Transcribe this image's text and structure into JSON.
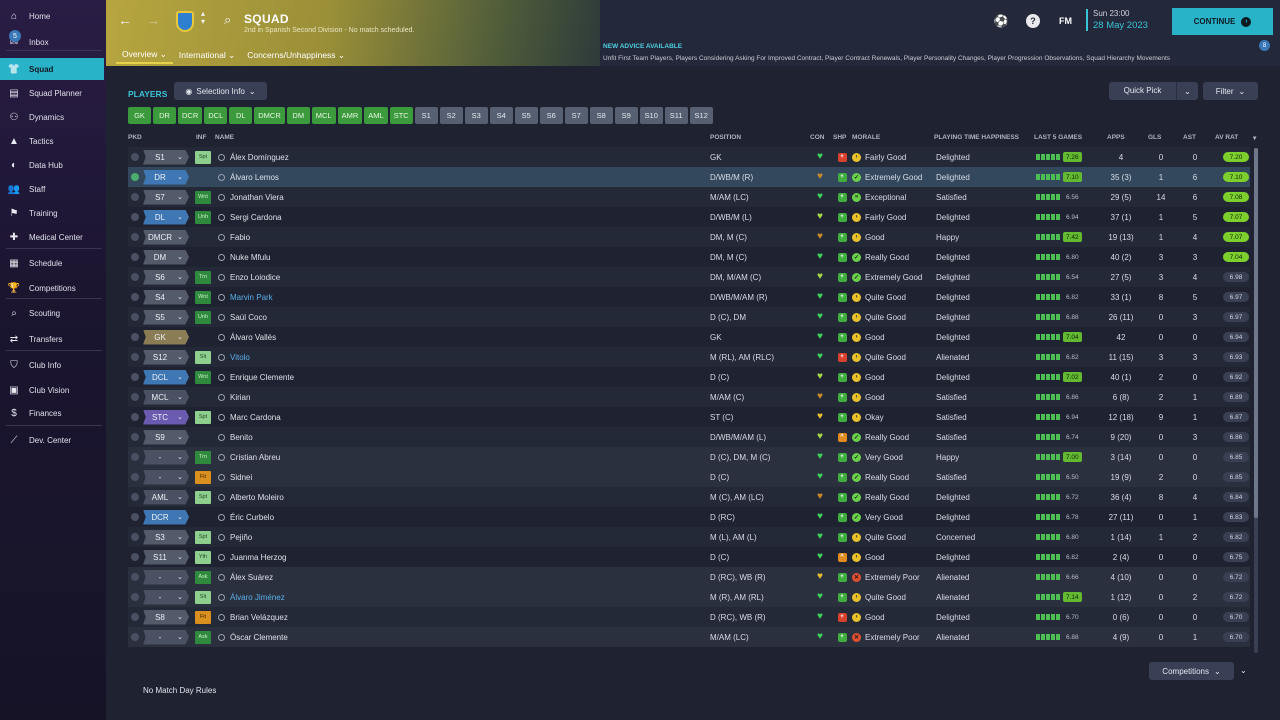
{
  "sidebar": {
    "items": [
      {
        "label": "Home",
        "icon": "home-icon",
        "glyph": "⌂"
      },
      {
        "label": "Inbox",
        "icon": "inbox-icon",
        "glyph": "✉",
        "badge": "5"
      },
      {
        "label": "Squad",
        "icon": "shirt-icon",
        "glyph": "👕"
      },
      {
        "label": "Squad Planner",
        "icon": "planner-icon",
        "glyph": "▤"
      },
      {
        "label": "Dynamics",
        "icon": "dynamics-icon",
        "glyph": "⚇"
      },
      {
        "label": "Tactics",
        "icon": "tactics-icon",
        "glyph": "▲"
      },
      {
        "label": "Data Hub",
        "icon": "data-hub-icon",
        "glyph": "◐"
      },
      {
        "label": "Staff",
        "icon": "staff-icon",
        "glyph": "👥"
      },
      {
        "label": "Training",
        "icon": "training-icon",
        "glyph": "⚑"
      },
      {
        "label": "Medical Center",
        "icon": "medical-icon",
        "glyph": "✚"
      },
      {
        "label": "Schedule",
        "icon": "calendar-icon",
        "glyph": "▦"
      },
      {
        "label": "Competitions",
        "icon": "trophy-icon",
        "glyph": "🏆"
      },
      {
        "label": "Scouting",
        "icon": "scouting-icon",
        "glyph": "⌕"
      },
      {
        "label": "Transfers",
        "icon": "transfers-icon",
        "glyph": "⇄"
      },
      {
        "label": "Club Info",
        "icon": "shield-icon",
        "glyph": "⛉"
      },
      {
        "label": "Club Vision",
        "icon": "vision-icon",
        "glyph": "▣"
      },
      {
        "label": "Finances",
        "icon": "finances-icon",
        "glyph": "$"
      },
      {
        "label": "Dev. Center",
        "icon": "dev-center-icon",
        "glyph": "⟋"
      }
    ]
  },
  "header": {
    "title": "SQUAD",
    "subtitle": "2nd in Spanish Second Division - No match scheduled.",
    "tabs": [
      "Overview",
      "International",
      "Concerns/Unhappiness"
    ],
    "advice_title": "NEW ADVICE AVAILABLE",
    "advice_text": "Unfit First Team Players, Players Considering Asking For Improved Contract, Player Contract Renewals, Player Personality Changes, Player Progression Observations, Squad Hierarchy Movements",
    "advice_badge": "8",
    "fm": "FM",
    "time": "Sun 23:00",
    "date": "28 May 2023",
    "continue": "CONTINUE"
  },
  "toolbar": {
    "players_label": "PLAYERS",
    "selection_info": "Selection Info",
    "quick_pick": "Quick Pick",
    "filter": "Filter",
    "positions": [
      "GK",
      "DR",
      "DCR",
      "DCL",
      "DL",
      "DMCR",
      "DM",
      "MCL",
      "AMR",
      "AML",
      "STC"
    ],
    "subs": [
      "S1",
      "S2",
      "S3",
      "S4",
      "S5",
      "S6",
      "S7",
      "S8",
      "S9",
      "S10",
      "S11",
      "S12"
    ]
  },
  "columns": {
    "pkd": "PKD",
    "inf": "INF",
    "name": "NAME",
    "position": "POSITION",
    "con": "CON",
    "shp": "SHP",
    "morale": "MORALE",
    "pth": "PLAYING TIME HAPPINESS",
    "last5": "LAST 5 GAMES",
    "apps": "APPS",
    "gls": "GLS",
    "ast": "AST",
    "avrat": "AV RAT"
  },
  "players": [
    {
      "pkd": "S1",
      "pk": "gray",
      "inf": "Spt",
      "infc": "l",
      "name": "Álex Domínguez",
      "link": false,
      "pos": "GK",
      "con": "#3dd25a",
      "shp": "red",
      "morale": "Fairly Good",
      "mc": "#e9c22c",
      "mg": "›",
      "pth": "Delighted",
      "l5": "7.26",
      "l5h": true,
      "apps": "4",
      "gls": "0",
      "ast": "0",
      "av": "7.20",
      "avh": true,
      "bg": "even"
    },
    {
      "pkd": "DR",
      "pk": "blue",
      "inf": "",
      "infc": "",
      "name": "Álvaro Lemos",
      "link": false,
      "pos": "D/WB/M (R)",
      "con": "#c98a2a",
      "shp": "green",
      "morale": "Extremely Good",
      "mc": "#6ad04a",
      "mg": "✓",
      "pth": "Delighted",
      "l5": "7.10",
      "l5h": true,
      "apps": "35 (3)",
      "gls": "1",
      "ast": "6",
      "av": "7.10",
      "avh": true,
      "bg": "sel",
      "sel": true
    },
    {
      "pkd": "S7",
      "pk": "gray",
      "inf": "Wnt",
      "infc": "g",
      "name": "Jonathan Viera",
      "link": false,
      "pos": "M/AM (LC)",
      "con": "#3dd25a",
      "shp": "green",
      "morale": "Exceptional",
      "mc": "#6ad04a",
      "mg": "»",
      "pth": "Satisfied",
      "l5": "6.56",
      "l5h": false,
      "apps": "29 (5)",
      "gls": "14",
      "ast": "6",
      "av": "7.08",
      "avh": true,
      "bg": "even"
    },
    {
      "pkd": "DL",
      "pk": "blue",
      "inf": "Unh",
      "infc": "g",
      "name": "Sergi Cardona",
      "link": false,
      "pos": "D/WB/M (L)",
      "con": "#a7d846",
      "shp": "green",
      "morale": "Fairly Good",
      "mc": "#e9c22c",
      "mg": "›",
      "pth": "Delighted",
      "l5": "6.94",
      "l5h": false,
      "apps": "37 (1)",
      "gls": "1",
      "ast": "5",
      "av": "7.07",
      "avh": true,
      "bg": "odd"
    },
    {
      "pkd": "DMCR",
      "pk": "gray",
      "inf": "",
      "infc": "",
      "name": "Fabio",
      "link": false,
      "pos": "DM, M (C)",
      "con": "#c98a2a",
      "shp": "green",
      "morale": "Good",
      "mc": "#e9c22c",
      "mg": "›",
      "pth": "Happy",
      "l5": "7.42",
      "l5h": true,
      "apps": "19 (13)",
      "gls": "1",
      "ast": "4",
      "av": "7.07",
      "avh": true,
      "bg": "even"
    },
    {
      "pkd": "DM",
      "pk": "gray",
      "inf": "",
      "infc": "",
      "name": "Nuke Mfulu",
      "link": false,
      "pos": "DM, M (C)",
      "con": "#3dd25a",
      "shp": "green",
      "morale": "Really Good",
      "mc": "#6ad04a",
      "mg": "✓",
      "pth": "Delighted",
      "l5": "6.80",
      "l5h": false,
      "apps": "40 (2)",
      "gls": "3",
      "ast": "3",
      "av": "7.04",
      "avh": true,
      "bg": "odd"
    },
    {
      "pkd": "S6",
      "pk": "gray",
      "inf": "Trn",
      "infc": "g",
      "name": "Enzo Loiodice",
      "link": false,
      "pos": "DM, M/AM (C)",
      "con": "#a7d846",
      "shp": "green",
      "morale": "Extremely Good",
      "mc": "#6ad04a",
      "mg": "✓",
      "pth": "Delighted",
      "l5": "6.54",
      "l5h": false,
      "apps": "27 (5)",
      "gls": "3",
      "ast": "4",
      "av": "6.98",
      "avh": false,
      "bg": "even"
    },
    {
      "pkd": "S4",
      "pk": "gray",
      "inf": "Wnt",
      "infc": "g",
      "name": "Marvin Park",
      "link": true,
      "pos": "D/WB/M/AM (R)",
      "con": "#3dd25a",
      "shp": "green",
      "morale": "Quite Good",
      "mc": "#e9c22c",
      "mg": "›",
      "pth": "Delighted",
      "l5": "6.82",
      "l5h": false,
      "apps": "33 (1)",
      "gls": "8",
      "ast": "5",
      "av": "6.97",
      "avh": false,
      "bg": "odd"
    },
    {
      "pkd": "S5",
      "pk": "gray",
      "inf": "Unh",
      "infc": "g",
      "name": "Saúl Coco",
      "link": false,
      "pos": "D (C), DM",
      "con": "#3dd25a",
      "shp": "green",
      "morale": "Quite Good",
      "mc": "#e9c22c",
      "mg": "›",
      "pth": "Delighted",
      "l5": "6.88",
      "l5h": false,
      "apps": "26 (11)",
      "gls": "0",
      "ast": "3",
      "av": "6.97",
      "avh": false,
      "bg": "even"
    },
    {
      "pkd": "GK",
      "pk": "tan",
      "inf": "",
      "infc": "",
      "name": "Álvaro Vallés",
      "link": false,
      "pos": "GK",
      "con": "#3dd25a",
      "shp": "green",
      "morale": "Good",
      "mc": "#e9c22c",
      "mg": "›",
      "pth": "Delighted",
      "l5": "7.04",
      "l5h": true,
      "apps": "42",
      "gls": "0",
      "ast": "0",
      "av": "6.94",
      "avh": false,
      "bg": "odd"
    },
    {
      "pkd": "S12",
      "pk": "gray",
      "inf": "Slt",
      "infc": "l",
      "name": "Vitolo",
      "link": true,
      "pos": "M (RL), AM (RLC)",
      "con": "#3dd25a",
      "shp": "red",
      "morale": "Quite Good",
      "mc": "#e9c22c",
      "mg": "›",
      "pth": "Alienated",
      "l5": "6.82",
      "l5h": false,
      "apps": "11 (15)",
      "gls": "3",
      "ast": "3",
      "av": "6.93",
      "avh": false,
      "bg": "even"
    },
    {
      "pkd": "DCL",
      "pk": "blue",
      "inf": "Wnt",
      "infc": "g",
      "name": "Enrique Clemente",
      "link": false,
      "pos": "D (C)",
      "con": "#a7d846",
      "shp": "green",
      "morale": "Good",
      "mc": "#e9c22c",
      "mg": "›",
      "pth": "Delighted",
      "l5": "7.02",
      "l5h": true,
      "apps": "40 (1)",
      "gls": "2",
      "ast": "0",
      "av": "6.92",
      "avh": false,
      "bg": "odd"
    },
    {
      "pkd": "MCL",
      "pk": "none",
      "inf": "",
      "infc": "",
      "name": "Kirian",
      "link": false,
      "pos": "M/AM (C)",
      "con": "#c98a2a",
      "shp": "green",
      "morale": "Good",
      "mc": "#e9c22c",
      "mg": "›",
      "pth": "Satisfied",
      "l5": "6.86",
      "l5h": false,
      "apps": "6 (8)",
      "gls": "2",
      "ast": "1",
      "av": "6.89",
      "avh": false,
      "bg": "even"
    },
    {
      "pkd": "STC",
      "pk": "purple",
      "inf": "Spt",
      "infc": "l",
      "name": "Marc Cardona",
      "link": false,
      "pos": "ST (C)",
      "con": "#e9c22c",
      "shp": "green",
      "morale": "Okay",
      "mc": "#e9c22c",
      "mg": "›",
      "pth": "Satisfied",
      "l5": "6.94",
      "l5h": false,
      "apps": "12 (18)",
      "gls": "9",
      "ast": "1",
      "av": "6.87",
      "avh": false,
      "bg": "odd"
    },
    {
      "pkd": "S9",
      "pk": "gray",
      "inf": "",
      "infc": "",
      "name": "Benito",
      "link": false,
      "pos": "D/WB/M/AM (L)",
      "con": "#a7d846",
      "shp": "orange",
      "morale": "Really Good",
      "mc": "#6ad04a",
      "mg": "✓",
      "pth": "Satisfied",
      "l5": "6.74",
      "l5h": false,
      "apps": "9 (20)",
      "gls": "0",
      "ast": "3",
      "av": "6.86",
      "avh": false,
      "bg": "even"
    },
    {
      "pkd": "-",
      "pk": "none",
      "inf": "Trn",
      "infc": "g",
      "name": "Cristian Abreu",
      "link": false,
      "pos": "D (C), DM, M (C)",
      "con": "#3dd25a",
      "shp": "green",
      "morale": "Very Good",
      "mc": "#6ad04a",
      "mg": "✓",
      "pth": "Happy",
      "l5": "7.00",
      "l5h": true,
      "apps": "3 (14)",
      "gls": "0",
      "ast": "0",
      "av": "6.85",
      "avh": false,
      "bg": "unreg"
    },
    {
      "pkd": "-",
      "pk": "none",
      "inf": "Fit",
      "infc": "o",
      "name": "Sidnei",
      "link": false,
      "pos": "D (C)",
      "con": "#3dd25a",
      "shp": "green",
      "morale": "Really Good",
      "mc": "#6ad04a",
      "mg": "✓",
      "pth": "Satisfied",
      "l5": "6.50",
      "l5h": false,
      "apps": "19 (9)",
      "gls": "2",
      "ast": "0",
      "av": "6.85",
      "avh": false,
      "bg": "unreg"
    },
    {
      "pkd": "AML",
      "pk": "none",
      "inf": "Spt",
      "infc": "l",
      "name": "Alberto Moleiro",
      "link": false,
      "pos": "M (C), AM (LC)",
      "con": "#c98a2a",
      "shp": "green",
      "morale": "Really Good",
      "mc": "#6ad04a",
      "mg": "✓",
      "pth": "Delighted",
      "l5": "6.72",
      "l5h": false,
      "apps": "36 (4)",
      "gls": "8",
      "ast": "4",
      "av": "6.84",
      "avh": false,
      "bg": "even"
    },
    {
      "pkd": "DCR",
      "pk": "blue",
      "inf": "",
      "infc": "",
      "name": "Éric Curbelo",
      "link": false,
      "pos": "D (RC)",
      "con": "#3dd25a",
      "shp": "green",
      "morale": "Very Good",
      "mc": "#6ad04a",
      "mg": "✓",
      "pth": "Delighted",
      "l5": "6.78",
      "l5h": false,
      "apps": "27 (11)",
      "gls": "0",
      "ast": "1",
      "av": "6.83",
      "avh": false,
      "bg": "odd"
    },
    {
      "pkd": "S3",
      "pk": "gray",
      "inf": "Spt",
      "infc": "l",
      "name": "Pejiño",
      "link": false,
      "pos": "M (L), AM (L)",
      "con": "#3dd25a",
      "shp": "green",
      "morale": "Quite Good",
      "mc": "#e9c22c",
      "mg": "›",
      "pth": "Concerned",
      "l5": "6.80",
      "l5h": false,
      "apps": "1 (14)",
      "gls": "1",
      "ast": "2",
      "av": "6.82",
      "avh": false,
      "bg": "even"
    },
    {
      "pkd": "S11",
      "pk": "gray",
      "inf": "Yth",
      "infc": "l",
      "name": "Juanma Herzog",
      "link": false,
      "pos": "D (C)",
      "con": "#3dd25a",
      "shp": "orange",
      "morale": "Good",
      "mc": "#e9c22c",
      "mg": "›",
      "pth": "Delighted",
      "l5": "6.82",
      "l5h": false,
      "apps": "2 (4)",
      "gls": "0",
      "ast": "0",
      "av": "6.75",
      "avh": false,
      "bg": "odd"
    },
    {
      "pkd": "-",
      "pk": "none",
      "inf": "Ask",
      "infc": "g",
      "name": "Álex Suárez",
      "link": false,
      "pos": "D (RC), WB (R)",
      "con": "#e9c22c",
      "shp": "green",
      "morale": "Extremely Poor",
      "mc": "#e05030",
      "mg": "✕",
      "pth": "Alienated",
      "l5": "6.66",
      "l5h": false,
      "apps": "4 (10)",
      "gls": "0",
      "ast": "0",
      "av": "6.72",
      "avh": false,
      "bg": "unreg"
    },
    {
      "pkd": "-",
      "pk": "none",
      "inf": "Slt",
      "infc": "l",
      "name": "Álvaro Jiménez",
      "link": true,
      "pos": "M (R), AM (RL)",
      "con": "#3dd25a",
      "shp": "green",
      "morale": "Quite Good",
      "mc": "#e9c22c",
      "mg": "›",
      "pth": "Alienated",
      "l5": "7.14",
      "l5h": true,
      "apps": "1 (12)",
      "gls": "0",
      "ast": "2",
      "av": "6.72",
      "avh": false,
      "bg": "unreg"
    },
    {
      "pkd": "S8",
      "pk": "gray",
      "inf": "Fit",
      "infc": "o",
      "name": "Brian Velázquez",
      "link": false,
      "pos": "D (RC), WB (R)",
      "con": "#3dd25a",
      "shp": "red",
      "morale": "Good",
      "mc": "#e9c22c",
      "mg": "›",
      "pth": "Delighted",
      "l5": "6.70",
      "l5h": false,
      "apps": "0 (6)",
      "gls": "0",
      "ast": "0",
      "av": "6.70",
      "avh": false,
      "bg": "even"
    },
    {
      "pkd": "-",
      "pk": "none",
      "inf": "Ask",
      "infc": "g",
      "name": "Óscar Clemente",
      "link": false,
      "pos": "M/AM (LC)",
      "con": "#3dd25a",
      "shp": "green",
      "morale": "Extremely Poor",
      "mc": "#e05030",
      "mg": "✕",
      "pth": "Alienated",
      "l5": "6.88",
      "l5h": false,
      "apps": "4 (9)",
      "gls": "0",
      "ast": "1",
      "av": "6.70",
      "avh": false,
      "bg": "unreg"
    }
  ],
  "footer": {
    "rule": "No Match Day Rules",
    "competitions": "Competitions"
  }
}
